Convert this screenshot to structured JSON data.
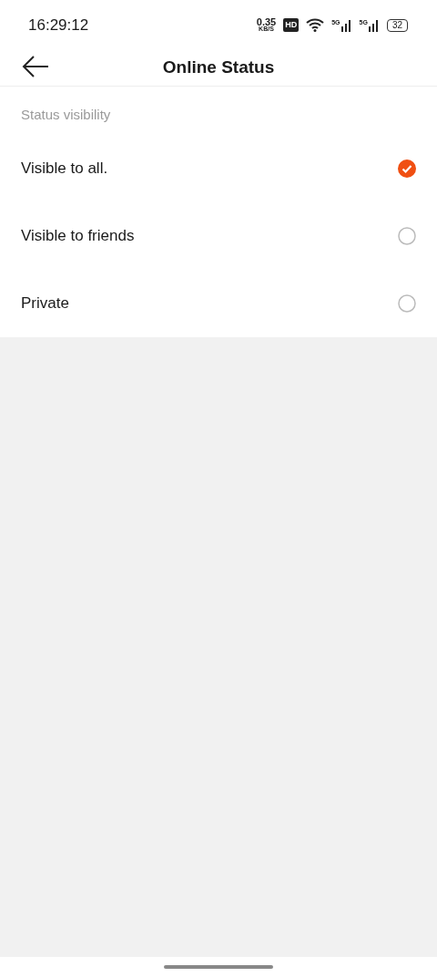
{
  "status_bar": {
    "time": "16:29:12",
    "net_speed": "0.35",
    "net_unit": "KB/S",
    "hd_badge": "HD",
    "sim_1": "5G",
    "sim_2": "5G",
    "battery": "32"
  },
  "header": {
    "title": "Online Status"
  },
  "section": {
    "label": "Status visibility"
  },
  "options": [
    {
      "label": "Visible to all.",
      "selected": true
    },
    {
      "label": "Visible to friends",
      "selected": false
    },
    {
      "label": "Private",
      "selected": false
    }
  ]
}
